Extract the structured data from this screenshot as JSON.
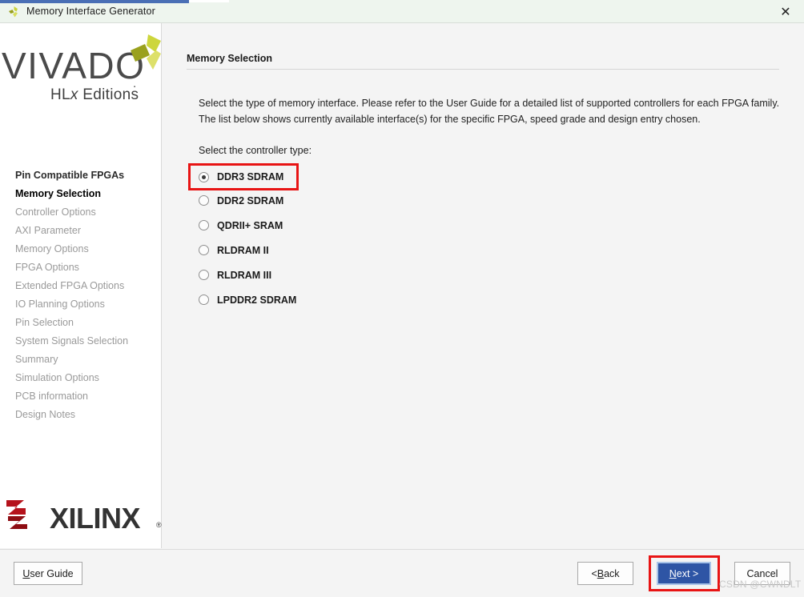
{
  "window": {
    "title": "Memory Interface Generator",
    "icon": "vivado-triangle-icon",
    "close_label": "✕"
  },
  "sidebar": {
    "logo": {
      "wordmark": "VIVADO",
      "dot": ".",
      "edition_prefix": "HL",
      "edition_italic": "x",
      "edition_suffix": " Editions"
    },
    "items": [
      {
        "label": "Pin Compatible FPGAs",
        "state": "done"
      },
      {
        "label": "Memory Selection",
        "state": "current"
      },
      {
        "label": "Controller Options",
        "state": "pending"
      },
      {
        "label": "AXI Parameter",
        "state": "pending"
      },
      {
        "label": "Memory Options",
        "state": "pending"
      },
      {
        "label": "FPGA Options",
        "state": "pending"
      },
      {
        "label": "Extended FPGA Options",
        "state": "pending"
      },
      {
        "label": "IO Planning Options",
        "state": "pending"
      },
      {
        "label": "Pin Selection",
        "state": "pending"
      },
      {
        "label": "System Signals Selection",
        "state": "pending"
      },
      {
        "label": "Summary",
        "state": "pending"
      },
      {
        "label": "Simulation Options",
        "state": "pending"
      },
      {
        "label": "PCB information",
        "state": "pending"
      },
      {
        "label": "Design Notes",
        "state": "pending"
      }
    ],
    "vendor_logo": {
      "wordmark": "XILINX",
      "registered": "®"
    }
  },
  "main": {
    "section_title": "Memory Selection",
    "description_line1": "Select the type of memory interface. Please refer to the User Guide for a detailed list of supported controllers for each FPGA family.",
    "description_line2": "The list below shows currently available interface(s) for the specific FPGA, speed grade and design entry chosen.",
    "prompt": "Select the controller type:",
    "controller_options": [
      {
        "label": "DDR3 SDRAM",
        "selected": true
      },
      {
        "label": "DDR2 SDRAM",
        "selected": false
      },
      {
        "label": "QDRII+ SRAM",
        "selected": false
      },
      {
        "label": "RLDRAM II",
        "selected": false
      },
      {
        "label": "RLDRAM III",
        "selected": false
      },
      {
        "label": "LPDDR2 SDRAM",
        "selected": false
      }
    ]
  },
  "footer": {
    "user_guide": {
      "mnemonic": "U",
      "rest": "ser Guide"
    },
    "back": {
      "prefix": "< ",
      "mnemonic": "B",
      "rest": "ack"
    },
    "next": {
      "mnemonic": "N",
      "rest": "ext >"
    },
    "cancel": {
      "label": "Cancel"
    }
  },
  "watermark": "CSDN @CWNDLT",
  "colors": {
    "titlebar_accent": "#4a6fb5",
    "highlight_red": "#e81414",
    "primary_button": "#2e55a5",
    "xilinx_red": "#b5121b",
    "vivado_green": "#c4d62e"
  }
}
